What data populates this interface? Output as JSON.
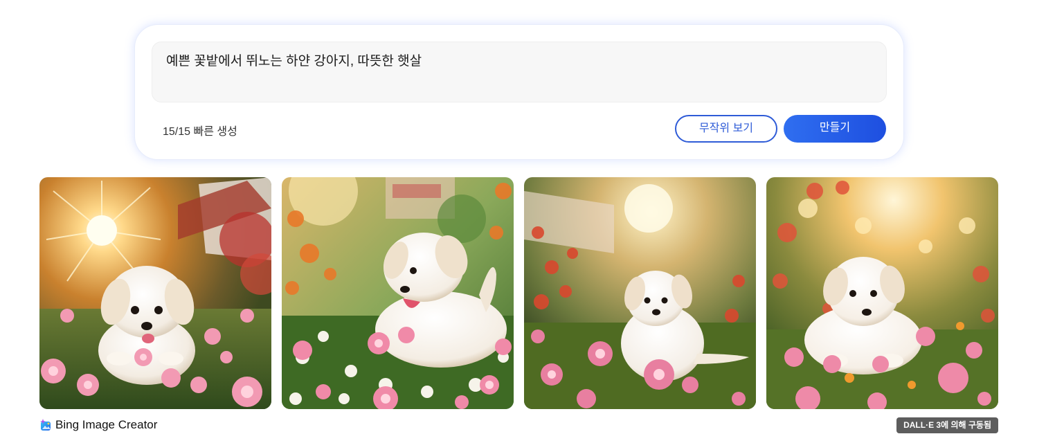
{
  "prompt": {
    "text": "예쁜 꽃밭에서 뛰노는 하얀 강아지, 따뜻한 햇살"
  },
  "boosts": {
    "label": "15/15 빠른 생성"
  },
  "buttons": {
    "surprise_label": "무작위 보기",
    "create_label": "만들기"
  },
  "colors": {
    "accent": "#2e5bd7",
    "create_button": "#2563eb",
    "badge_bg": "#5d5d5d"
  },
  "images": [
    {
      "subject": "white puppy in pink flower field, sunburst"
    },
    {
      "subject": "white puppy with tongue out among white and pink flowers"
    },
    {
      "subject": "white puppy sitting in garden with pink flowers"
    },
    {
      "subject": "white puppy in sunny flower garden"
    }
  ],
  "footer": {
    "brand": "Bing Image Creator",
    "powered_by": "DALL·E 3에 의해 구동됨"
  }
}
